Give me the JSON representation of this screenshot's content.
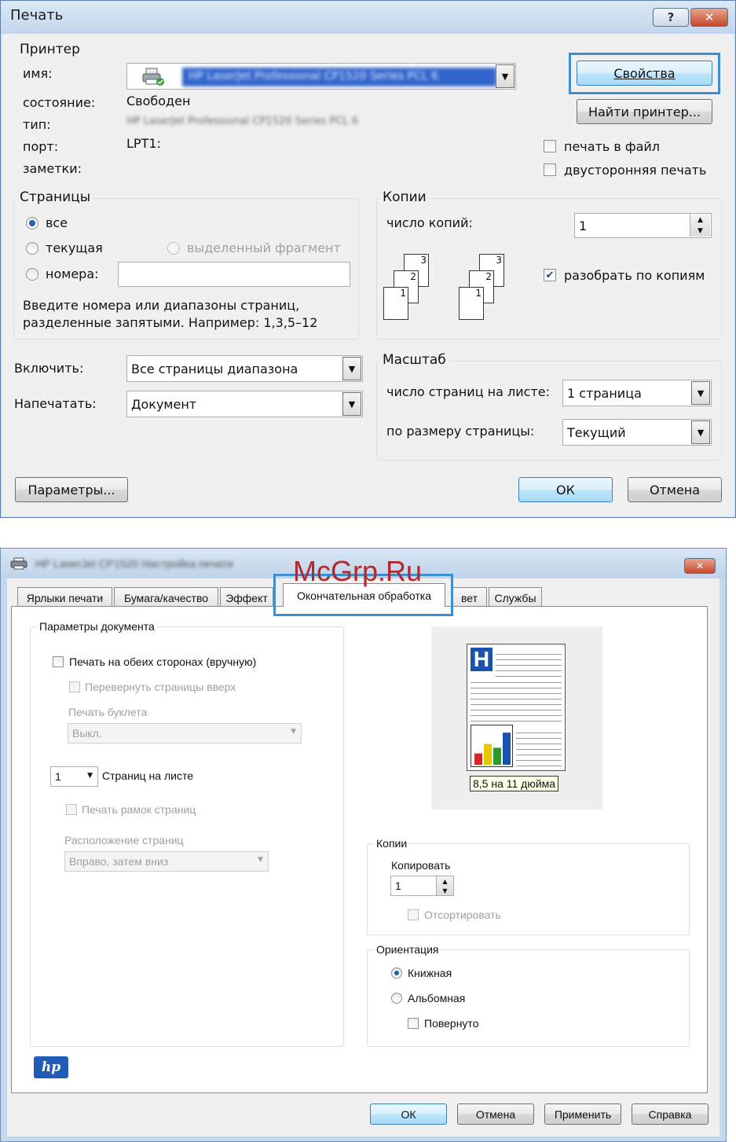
{
  "dialog1": {
    "title": "Печать",
    "help_glyph": "?",
    "close_glyph": "✕",
    "printer": {
      "group_title": "Принтер",
      "name_label": "имя:",
      "name_value": "HP LaserJet Professional CP1520 Series PCL 6",
      "status_label": "состояние:",
      "status_value": "Свободен",
      "type_label": "тип:",
      "type_value": "HP LaserJet Professional CP1520 Series PCL 6",
      "port_label": "порт:",
      "port_value": "LPT1:",
      "notes_label": "заметки:",
      "properties_button": "Свойства",
      "find_printer_button": "Найти принтер...",
      "print_to_file": "печать в файл",
      "duplex": "двусторонняя печать"
    },
    "pages": {
      "group_title": "Страницы",
      "all": "все",
      "current": "текущая",
      "selection": "выделенный фрагмент",
      "numbers": "номера:",
      "numbers_value": "",
      "hint_line1": "Введите номера или диапазоны страниц,",
      "hint_line2": "разделенные запятыми. Например: 1,3,5–12"
    },
    "copies": {
      "group_title": "Копии",
      "count_label": "число копий:",
      "count_value": "1",
      "collate": "разобрать по копиям",
      "stack_pages": [
        "3",
        "2",
        "1"
      ]
    },
    "include_label": "Включить:",
    "include_value": "Все страницы диапазона",
    "print_label": "Напечатать:",
    "print_value": "Документ",
    "scale": {
      "group_title": "Масштаб",
      "pages_per_sheet_label": "число страниц на листе:",
      "pages_per_sheet_value": "1 страница",
      "fit_label": "по размеру страницы:",
      "fit_value": "Текущий"
    },
    "options_button": "Параметры...",
    "ok_button": "ОК",
    "cancel_button": "Отмена"
  },
  "dialog2": {
    "title": "HP LaserJet CP1520 Настройка печати",
    "close_glyph": "✕",
    "watermark": "McGrp.Ru",
    "tabs": [
      "Ярлыки печати",
      "Бумага/качество",
      "Эффект",
      "Окончательная обработка",
      "вет",
      "Службы"
    ],
    "doc_params": {
      "group_title": "Параметры документа",
      "duplex_manual": "Печать на обеих сторонах (вручную)",
      "flip_pages_up": "Перевернуть страницы вверх",
      "booklet_label": "Печать буклета",
      "booklet_value": "Выкл.",
      "pages_per_sheet_value": "1",
      "pages_per_sheet_label": "Страниц на листе",
      "print_borders": "Печать рамок страниц",
      "page_order_label": "Расположение страниц",
      "page_order_value": "Вправо, затем вниз"
    },
    "preview": {
      "paper_size": "8,5 на 11 дюйма",
      "letter": "H",
      "bars": [
        30,
        55,
        45,
        85
      ]
    },
    "copies": {
      "group_title": "Копии",
      "copy_label": "Копировать",
      "copy_value": "1",
      "collate": "Отсортировать"
    },
    "orientation": {
      "group_title": "Ориентация",
      "portrait": "Книжная",
      "landscape": "Альбомная",
      "rotated": "Повернуто"
    },
    "logo": "hp",
    "ok_button": "ОК",
    "cancel_button": "Отмена",
    "apply_button": "Применить",
    "help_button": "Справка"
  },
  "colors": {
    "highlight": "#3d8fd0",
    "title_bar": "#c3d6ec",
    "close_red": "#c64a2c",
    "watermark": "#b3262a",
    "selection_blue": "#3366cc"
  }
}
